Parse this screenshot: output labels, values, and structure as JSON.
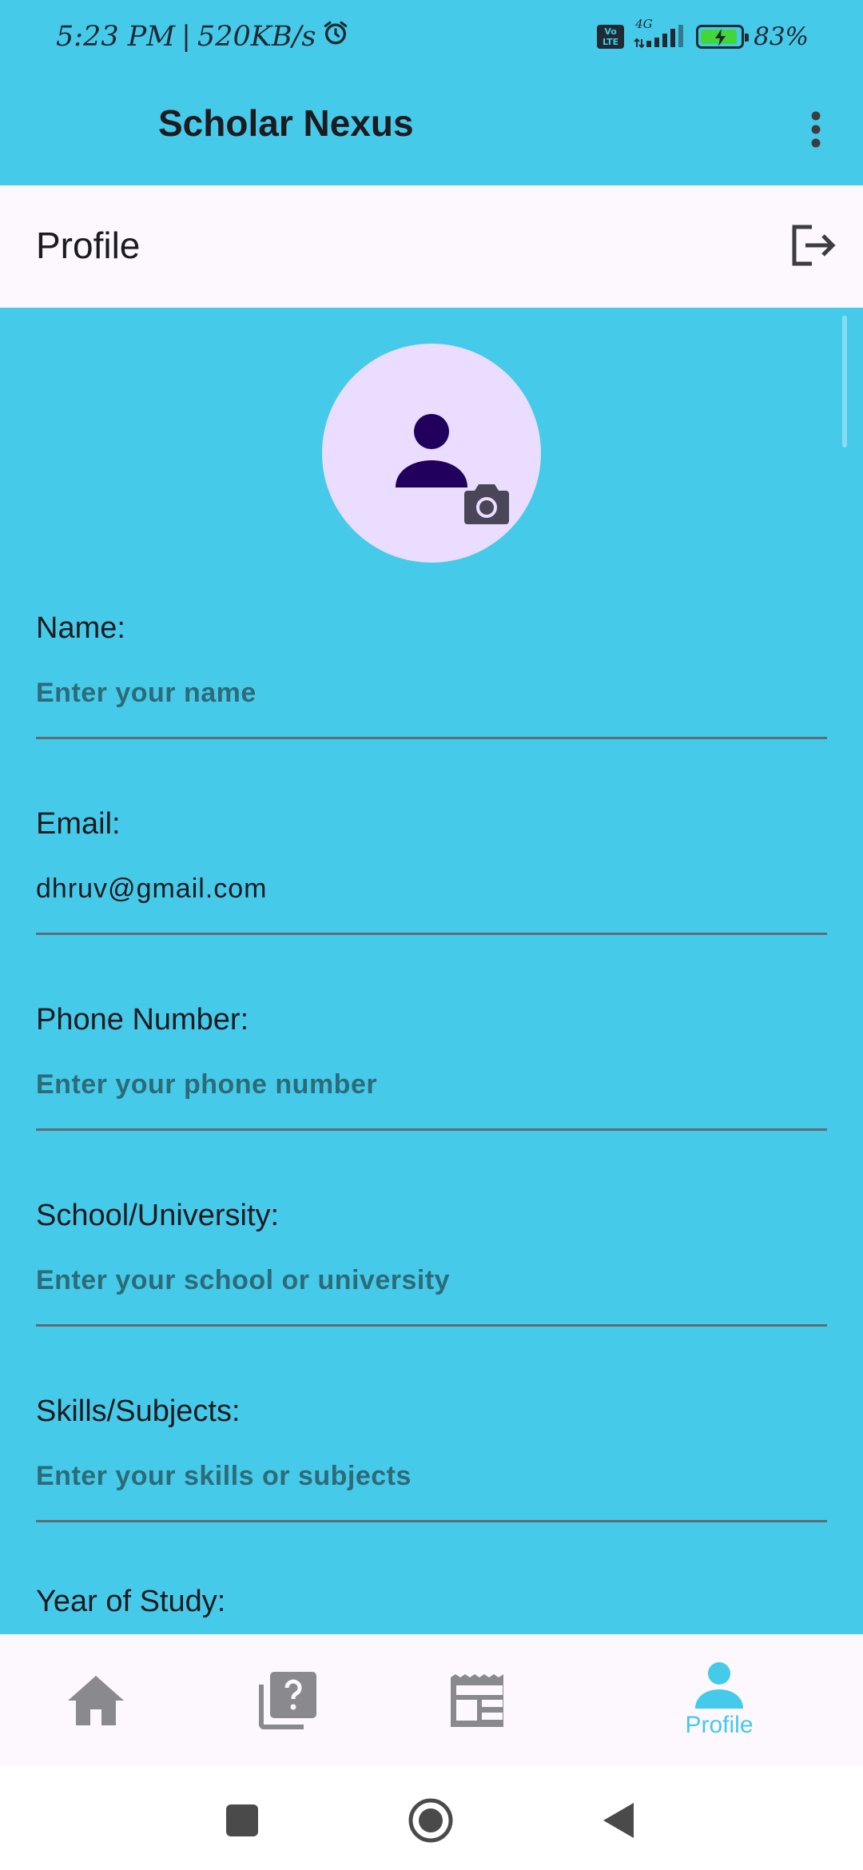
{
  "status_bar": {
    "time": "5:23 PM",
    "separator": "|",
    "net_speed": "520KB/s",
    "network_type": "4G",
    "volte": "Vo LTE",
    "battery": "83%",
    "battery_level": 0.83
  },
  "app_bar": {
    "title": "Scholar Nexus"
  },
  "profile_header": {
    "title": "Profile"
  },
  "form": {
    "fields": [
      {
        "label": "Name:",
        "placeholder": "Enter your name",
        "value": ""
      },
      {
        "label": "Email:",
        "placeholder": "",
        "value": "dhruv@gmail.com"
      },
      {
        "label": "Phone Number:",
        "placeholder": "Enter your phone number",
        "value": ""
      },
      {
        "label": "School/University:",
        "placeholder": "Enter your school or university",
        "value": ""
      },
      {
        "label": "Skills/Subjects:",
        "placeholder": "Enter your skills or subjects",
        "value": ""
      }
    ],
    "next_label_partial": "Year of Study:"
  },
  "bottom_nav": {
    "items": [
      {
        "icon": "home-icon",
        "label": ""
      },
      {
        "icon": "quiz-icon",
        "label": ""
      },
      {
        "icon": "news-icon",
        "label": ""
      },
      {
        "icon": "person-icon",
        "label": "Profile",
        "active": true
      }
    ]
  },
  "colors": {
    "background": "#46CAEA",
    "surface": "#FDF7FE",
    "avatar_bg": "#EADDFF",
    "avatar_icon": "#21005D",
    "inactive_icon": "#8A8A8E",
    "active": "#46CAEA"
  }
}
